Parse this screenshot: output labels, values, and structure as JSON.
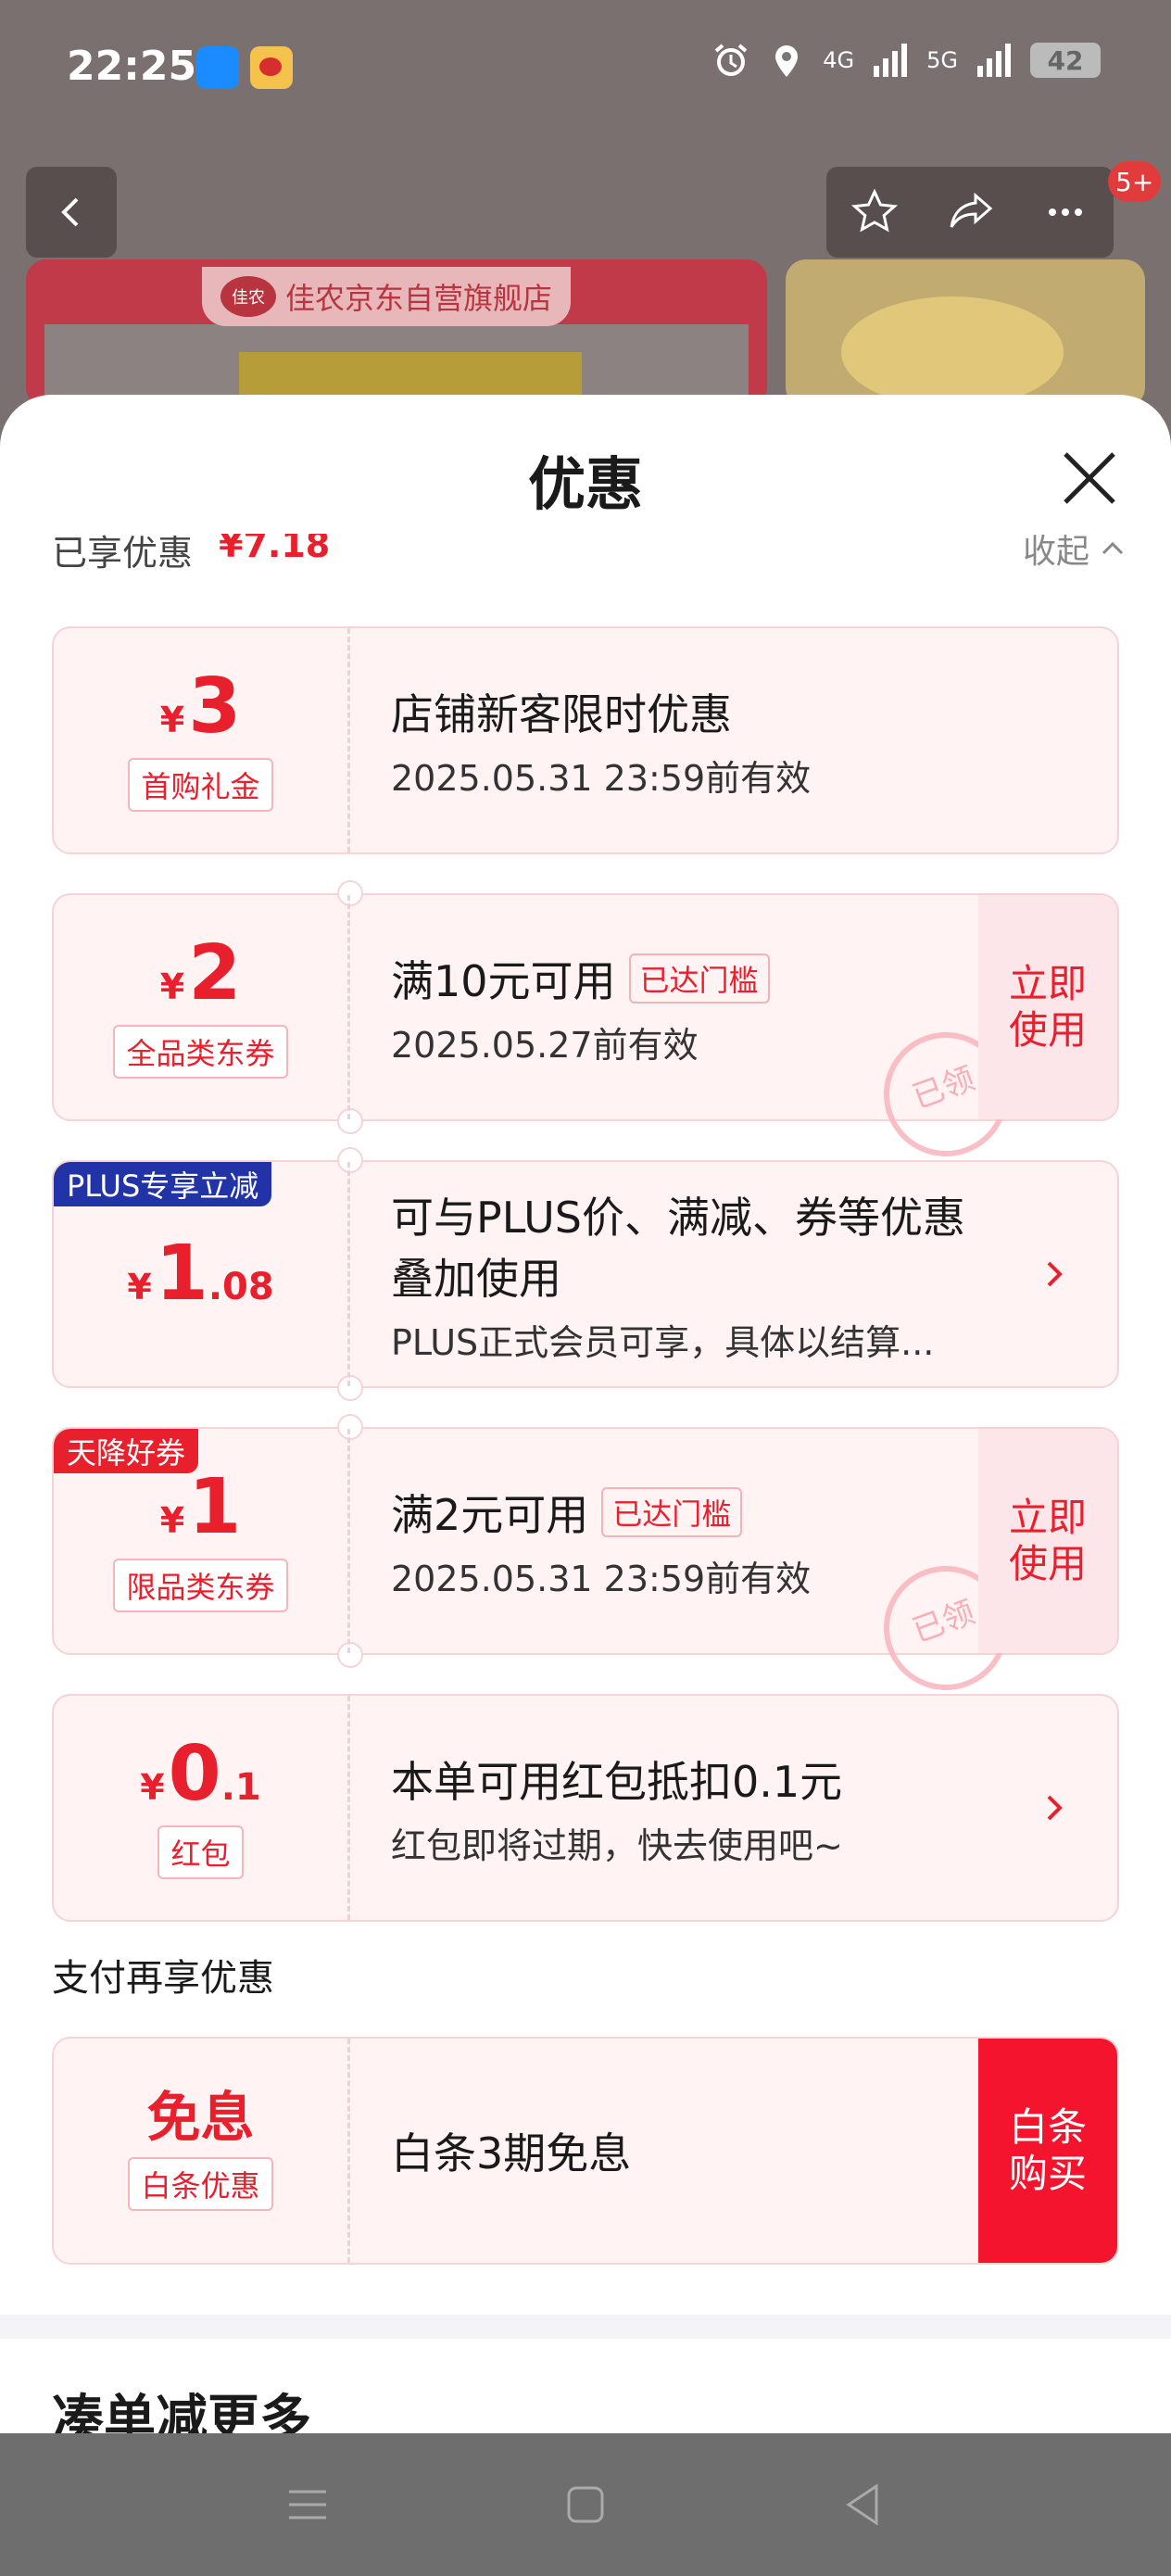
{
  "status_bar": {
    "time": "22:25",
    "network_4g": "4G",
    "network_5g": "5G",
    "battery": "42"
  },
  "background_page": {
    "store_name": "佳农京东自营旗舰店",
    "store_logo": "佳农",
    "notification_count": "5+"
  },
  "sheet": {
    "title": "优惠",
    "enjoyed_label": "已享优惠",
    "enjoyed_amount": "¥7.18",
    "collapse_label": "收起",
    "coupons": [
      {
        "yen": "¥",
        "int": "3",
        "dec": "",
        "tag": "首购礼金",
        "title": "店铺新客限时优惠",
        "sub": "2025.05.31 23:59前有效"
      },
      {
        "yen": "¥",
        "int": "2",
        "dec": "",
        "tag": "全品类东券",
        "title": "满10元可用",
        "reached": "已达门槛",
        "sub": "2025.05.27前有效",
        "action": "立即\n使用",
        "stamp": "已领"
      },
      {
        "corner": "PLUS专享立减",
        "yen": "¥",
        "int": "1",
        "dec": ".08",
        "title": "可与PLUS价、满减、券等优惠",
        "title2": "叠加使用",
        "sub": "PLUS正式会员可享，具体以结算..."
      },
      {
        "corner": "天降好券",
        "yen": "¥",
        "int": "1",
        "dec": "",
        "tag": "限品类东券",
        "title": "满2元可用",
        "reached": "已达门槛",
        "sub": "2025.05.31 23:59前有效",
        "action": "立即\n使用",
        "stamp": "已领"
      },
      {
        "yen": "¥",
        "int": "0",
        "dec": ".1",
        "tag": "红包",
        "title": "本单可用红包抵扣0.1元",
        "sub": "红包即将过期，快去使用吧~"
      }
    ],
    "pay_section_label": "支付再享优惠",
    "pay_coupon": {
      "word": "免息",
      "tag": "白条优惠",
      "title": "白条3期免息",
      "action": "白条\n购买"
    },
    "more_title": "凑单减更多"
  },
  "colors": {
    "accent": "#e8202e",
    "plus": "#2233a8",
    "coupon_bg": "#fff3f3"
  }
}
